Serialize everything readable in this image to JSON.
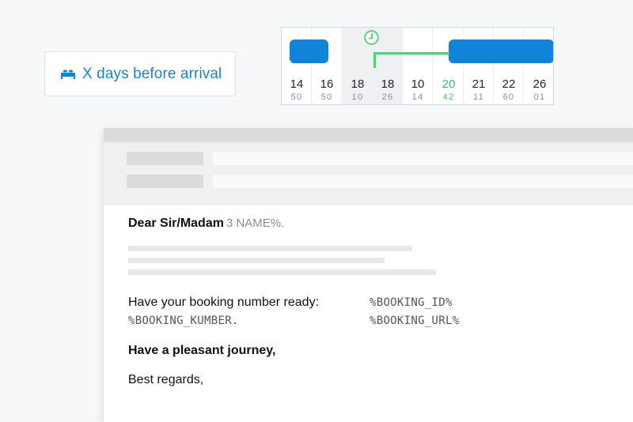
{
  "trigger": {
    "icon": "bed-icon",
    "label": "X days before arrival",
    "color": "#1a82d6"
  },
  "timeline": {
    "columns": [
      {
        "day": "14",
        "sub": "50"
      },
      {
        "day": "16",
        "sub": "50"
      },
      {
        "day": "18",
        "sub": "10"
      },
      {
        "day": "18",
        "sub": "26"
      },
      {
        "day": "10",
        "sub": "14"
      },
      {
        "day": "20",
        "sub": "42",
        "highlight": true
      },
      {
        "day": "21",
        "sub": "11"
      },
      {
        "day": "22",
        "sub": "60"
      },
      {
        "day": "26",
        "sub": "01"
      }
    ],
    "clock_icon": "clock-icon",
    "bar_color": "#0f84d8",
    "accent_color": "#3cc470"
  },
  "email": {
    "greeting": "Dear Sir/Madam",
    "greeting_placeholder": "3 NAME%.",
    "line1_text": "Have your booking number ready:",
    "line1_var": "%BOOKING_ID%",
    "line2_text": "%BOOKING_KUMBER.",
    "line2_var": "%BOOKING_URL%",
    "closing": "Have a pleasant journey,",
    "signoff": "Best regards,"
  }
}
